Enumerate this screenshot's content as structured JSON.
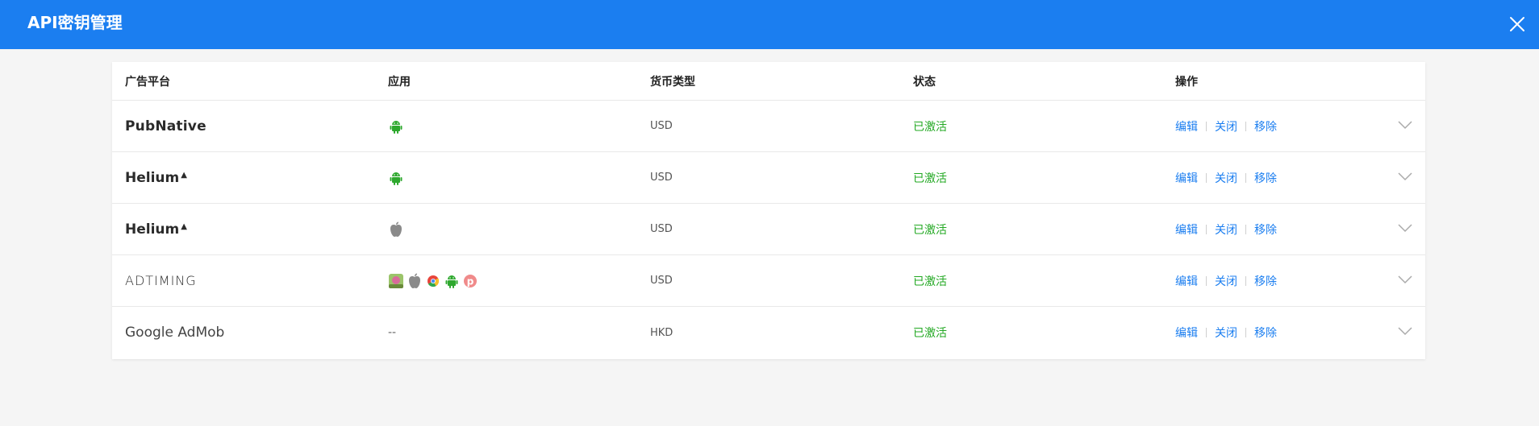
{
  "header": {
    "title": "API密钥管理"
  },
  "table": {
    "columns": [
      "广告平台",
      "应用",
      "货币类型",
      "状态",
      "操作"
    ],
    "rows": [
      {
        "platform": "PubNative",
        "apps": [
          "android-icon"
        ],
        "currency": "USD",
        "status": "已激活"
      },
      {
        "platform": "Helium",
        "apps": [
          "android-icon"
        ],
        "currency": "USD",
        "status": "已激活"
      },
      {
        "platform": "Helium",
        "apps": [
          "apple-icon"
        ],
        "currency": "USD",
        "status": "已激活"
      },
      {
        "platform": "ADTIMING",
        "apps": [
          "app-thumbnail-icon",
          "apple-icon",
          "chrome-icon",
          "android-icon",
          "pinterest-icon"
        ],
        "currency": "USD",
        "status": "已激活"
      },
      {
        "platform": "Google AdMob",
        "apps": [],
        "apps_text": "--",
        "currency": "HKD",
        "status": "已激活"
      }
    ],
    "actions": {
      "edit": "编辑",
      "close": "关闭",
      "remove": "移除"
    }
  },
  "colors": {
    "header_bg": "#1b7ef0",
    "status_active": "#22a822",
    "link": "#1b7ef0",
    "android": "#2ea82e",
    "apple": "#8a8a8a"
  }
}
